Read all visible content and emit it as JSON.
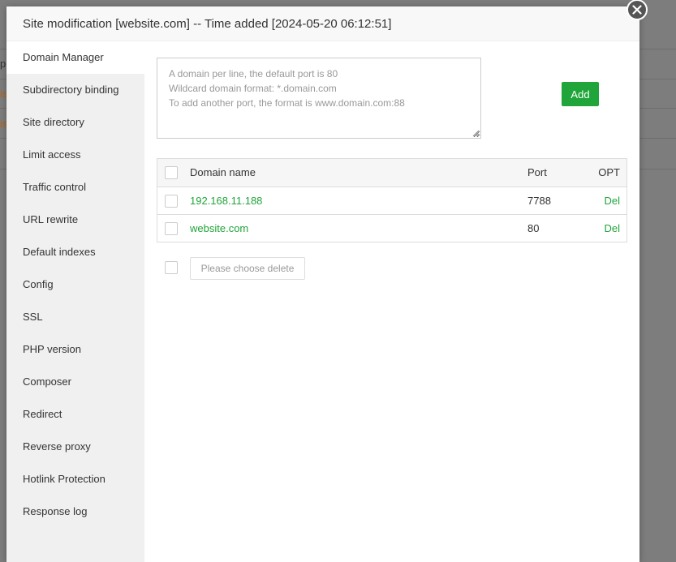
{
  "background": {
    "left_fragments": [
      "p",
      "is",
      "is"
    ]
  },
  "dialog": {
    "title": "Site modification [website.com] -- Time added [2024-05-20 06:12:51]",
    "close_icon": "close-icon"
  },
  "sidebar": {
    "items": [
      {
        "label": "Domain Manager",
        "active": true
      },
      {
        "label": "Subdirectory binding"
      },
      {
        "label": "Site directory"
      },
      {
        "label": "Limit access"
      },
      {
        "label": "Traffic control"
      },
      {
        "label": "URL rewrite"
      },
      {
        "label": "Default indexes"
      },
      {
        "label": "Config"
      },
      {
        "label": "SSL"
      },
      {
        "label": "PHP version"
      },
      {
        "label": "Composer"
      },
      {
        "label": "Redirect"
      },
      {
        "label": "Reverse proxy"
      },
      {
        "label": "Hotlink Protection"
      },
      {
        "label": "Response log"
      }
    ]
  },
  "domain_form": {
    "placeholder_lines": [
      "A domain per line, the default port is 80",
      "Wildcard domain format: *.domain.com",
      "To add another port, the format is www.domain.com:88"
    ],
    "value": "",
    "add_label": "Add"
  },
  "table": {
    "headers": {
      "name": "Domain name",
      "port": "Port",
      "opt": "OPT"
    },
    "rows": [
      {
        "name": "192.168.11.188",
        "port": "7788",
        "opt": "Del"
      },
      {
        "name": "website.com",
        "port": "80",
        "opt": "Del"
      }
    ]
  },
  "bulk": {
    "delete_label": "Please choose delete"
  },
  "colors": {
    "accent": "#20a53a",
    "overlay": "#7d7d7d",
    "sidebar_bg": "#f0f0f0"
  }
}
